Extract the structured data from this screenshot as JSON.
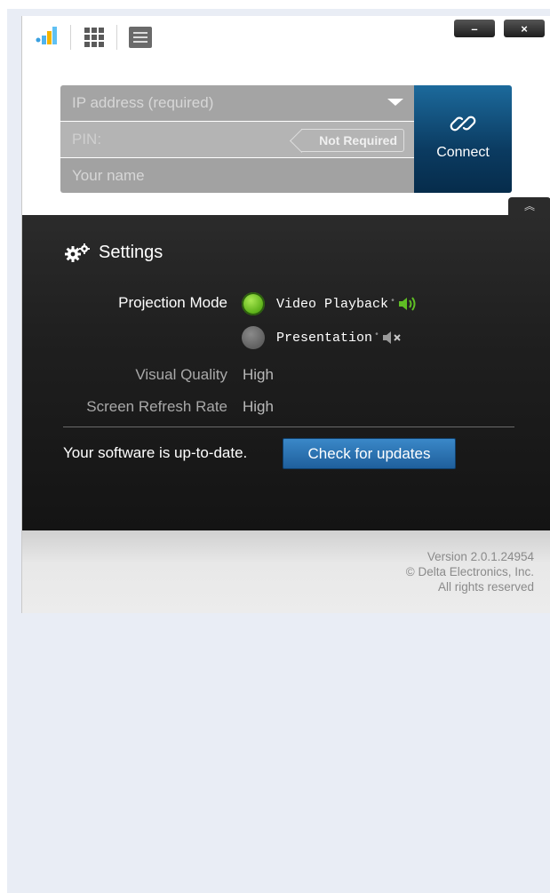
{
  "window": {
    "minimize_label": "–",
    "close_label": "×"
  },
  "form": {
    "ip_placeholder": "IP address (required)",
    "pin_placeholder": "PIN:",
    "pin_badge": "Not Required",
    "name_placeholder": "Your name",
    "connect_label": "Connect"
  },
  "settings": {
    "title": "Settings",
    "projection_mode_label": "Projection Mode",
    "modes": [
      {
        "label": "Video Playback",
        "selected": true,
        "sound": "speaker-on-icon"
      },
      {
        "label": "Presentation",
        "selected": false,
        "sound": "speaker-muted-icon"
      }
    ],
    "visual_quality_label": "Visual Quality",
    "visual_quality_value": "High",
    "refresh_rate_label": "Screen Refresh Rate",
    "refresh_rate_value": "High",
    "update_status": "Your software is up-to-date.",
    "update_button": "Check for updates"
  },
  "footer": {
    "version": "Version 2.0.1.24954",
    "copyright": "© Delta Electronics, Inc.",
    "rights": "All rights reserved"
  },
  "colors": {
    "accent_blue": "#1f5f9c",
    "selected_green": "#5fb21b",
    "panel_dark": "#1f1f1f"
  }
}
